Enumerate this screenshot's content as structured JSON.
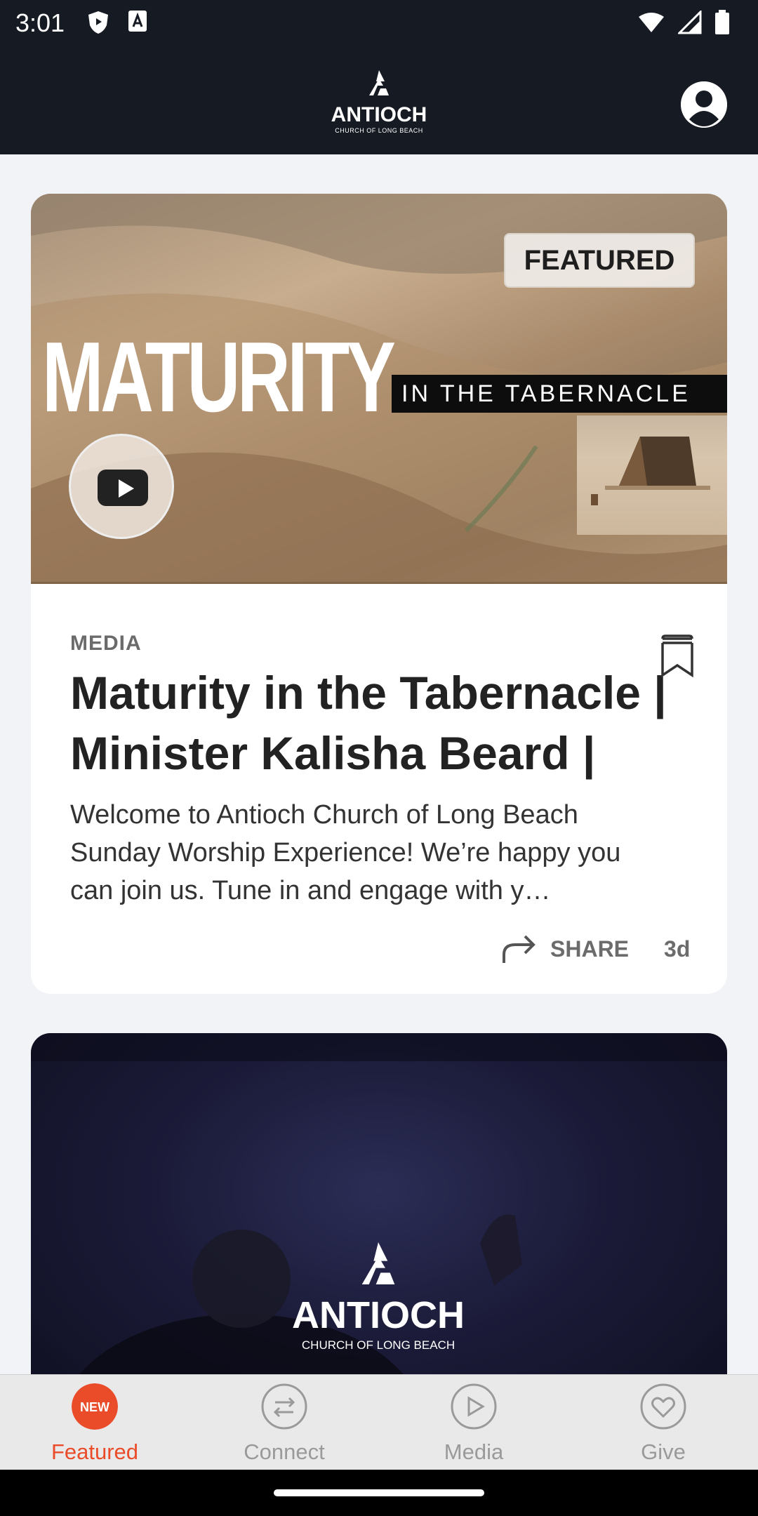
{
  "status_bar": {
    "time": "3:01",
    "icons_left": [
      "shield-icon",
      "a-font-icon"
    ],
    "icons_right": [
      "wifi-icon",
      "signal-icon",
      "battery-icon"
    ]
  },
  "header": {
    "logo_text": "ANTIOCH",
    "logo_sub": "CHURCH OF LONG BEACH",
    "profile_icon": "profile-icon"
  },
  "feed": {
    "cards": [
      {
        "hero": {
          "title_big": "MATURITY",
          "subtitle_bar": "IN THE TABERNACLE",
          "badge": "FEATURED"
        },
        "category": "MEDIA",
        "title": "Maturity in the Tabernacle | Minister Kalisha Beard | Ma..",
        "description": "Welcome to Antioch Church of Long Beach Sunday Worship Experience! We’re happy you can join us. Tune in and engage with y…",
        "share_label": "SHARE",
        "age": "3d"
      },
      {
        "hero": {
          "logo_text": "ANTIOCH",
          "logo_sub": "CHURCH OF LONG BEACH"
        }
      }
    ]
  },
  "bottom_nav": {
    "items": [
      {
        "label": "Featured",
        "badge": "NEW",
        "active": true
      },
      {
        "label": "Connect",
        "active": false
      },
      {
        "label": "Media",
        "active": false
      },
      {
        "label": "Give",
        "active": false
      }
    ]
  },
  "colors": {
    "accent": "#ea4c2a",
    "header_bg": "#161a22",
    "page_bg": "#f2f3f6"
  }
}
